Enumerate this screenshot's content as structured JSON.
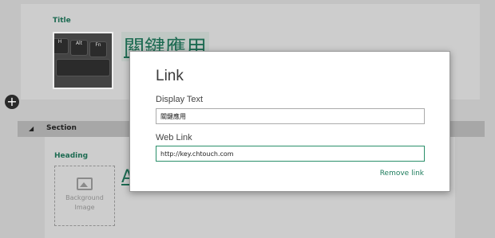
{
  "title_card": {
    "label": "Title",
    "title_text": "關鍵應用",
    "thumbnail_keys": [
      "H",
      "Alt",
      "Fn"
    ]
  },
  "section": {
    "collapse_symbol": "◢",
    "label": "Section"
  },
  "heading_card": {
    "label": "Heading",
    "background_image_label": "Background Image",
    "heading_text": "A"
  },
  "add_button": {
    "symbol": "+"
  },
  "dialog": {
    "title": "Link",
    "display_text_label": "Display Text",
    "display_text_value": "關鍵應用",
    "web_link_label": "Web Link",
    "web_link_value": "http://key.chtouch.com",
    "remove_link_label": "Remove link"
  },
  "colors": {
    "accent": "#1d6b52",
    "overlay_bg": "#c3c3c3",
    "dialog_bg": "#ffffff"
  }
}
